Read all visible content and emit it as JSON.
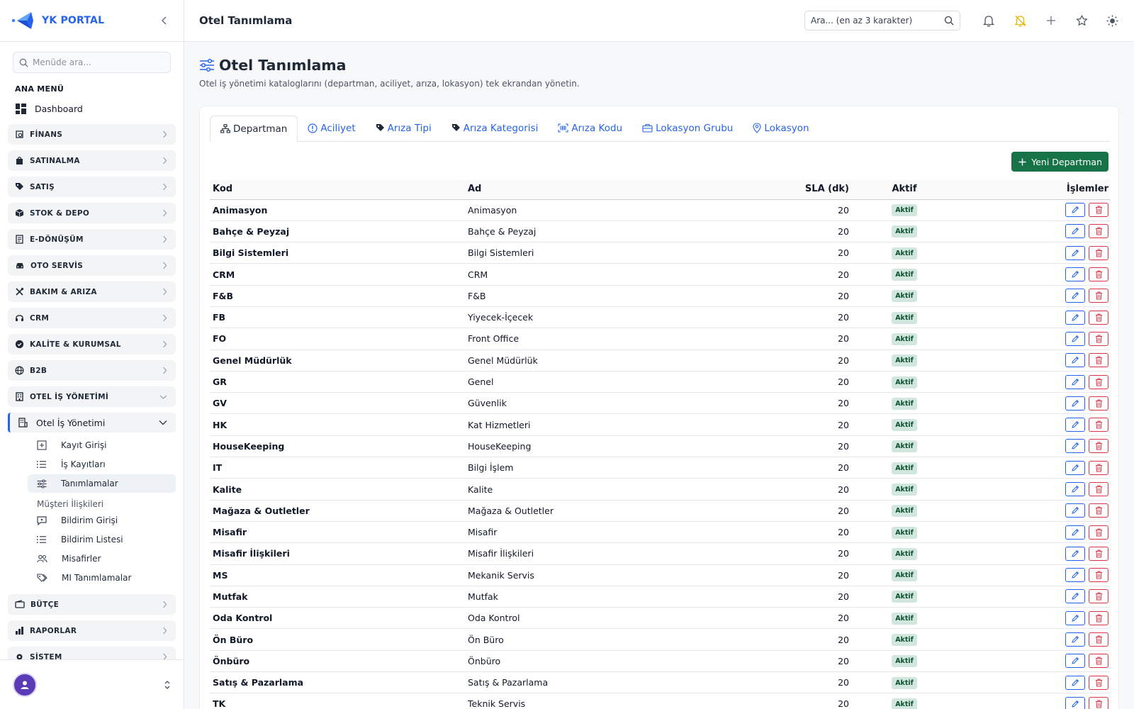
{
  "brand": {
    "name": "YK PORTAL"
  },
  "sidebar": {
    "search_placeholder": "Menüde ara...",
    "section_label": "ANA MENÜ",
    "dashboard_label": "Dashboard",
    "groups_before": [
      {
        "label": "FİNANS",
        "icon": "finance-icon"
      },
      {
        "label": "SATINALMA",
        "icon": "bag-icon"
      },
      {
        "label": "SATIŞ",
        "icon": "tag-icon"
      },
      {
        "label": "STOK & DEPO",
        "icon": "box-icon"
      },
      {
        "label": "E-DÖNÜŞÜM",
        "icon": "document-icon"
      },
      {
        "label": "OTO SERVİS",
        "icon": "car-icon"
      },
      {
        "label": "BAKIM & ARIZA",
        "icon": "tools-icon"
      },
      {
        "label": "CRM",
        "icon": "headset-icon"
      },
      {
        "label": "KALİTE & KURUMSAL",
        "icon": "badge-check-icon"
      },
      {
        "label": "B2B",
        "icon": "globe-icon"
      }
    ],
    "open_group": {
      "label": "OTEL İŞ YÖNETİMİ"
    },
    "sub_parent": {
      "label": "Otel İş Yönetimi"
    },
    "sub_items_1": [
      {
        "label": "Kayıt Girişi",
        "icon": "plus-square-icon"
      },
      {
        "label": "İş Kayıtları",
        "icon": "list-icon"
      },
      {
        "label": "Tanımlamalar",
        "icon": "sliders-icon",
        "active": true
      }
    ],
    "sub_heading": "Müşteri İlişkileri",
    "sub_items_2": [
      {
        "label": "Bildirim Girişi",
        "icon": "message-icon"
      },
      {
        "label": "Bildirim Listesi",
        "icon": "list-icon"
      },
      {
        "label": "Misafirler",
        "icon": "people-icon"
      },
      {
        "label": "MI Tanımlamalar",
        "icon": "tags-icon"
      }
    ],
    "groups_after": [
      {
        "label": "BÜTÇE",
        "icon": "wallet-icon"
      },
      {
        "label": "RAPORLAR",
        "icon": "bar-chart-icon"
      },
      {
        "label": "SİSTEM",
        "icon": "gear-icon"
      }
    ]
  },
  "topbar": {
    "title": "Otel Tanımlama",
    "search_placeholder": "Ara... (en az 3 karakter)"
  },
  "page": {
    "title": "Otel Tanımlama",
    "subtitle": "Otel iş yönetimi kataloglarını (departman, aciliyet, arıza, lokasyon) tek ekrandan yönetin."
  },
  "tabs": [
    {
      "label": "Departman",
      "icon": "diagram-icon",
      "active": true
    },
    {
      "label": "Aciliyet",
      "icon": "alert-circle-icon"
    },
    {
      "label": "Arıza Tipi",
      "icon": "tag-icon"
    },
    {
      "label": "Arıza Kategorisi",
      "icon": "tag-icon"
    },
    {
      "label": "Arıza Kodu",
      "icon": "barcode-icon"
    },
    {
      "label": "Lokasyon Grubu",
      "icon": "briefcase-icon"
    },
    {
      "label": "Lokasyon",
      "icon": "map-pin-icon"
    }
  ],
  "new_button": {
    "label": "Yeni Departman"
  },
  "table": {
    "headers": {
      "kod": "Kod",
      "ad": "Ad",
      "sla": "SLA (dk)",
      "aktif": "Aktif",
      "islemler": "İşlemler"
    },
    "rows": [
      {
        "kod": "Animasyon",
        "ad": "Animasyon",
        "sla": "20",
        "aktif": "Aktif"
      },
      {
        "kod": "Bahçe & Peyzaj",
        "ad": "Bahçe & Peyzaj",
        "sla": "20",
        "aktif": "Aktif"
      },
      {
        "kod": "Bilgi Sistemleri",
        "ad": "Bilgi Sistemleri",
        "sla": "20",
        "aktif": "Aktif"
      },
      {
        "kod": "CRM",
        "ad": "CRM",
        "sla": "20",
        "aktif": "Aktif"
      },
      {
        "kod": "F&B",
        "ad": "F&B",
        "sla": "20",
        "aktif": "Aktif"
      },
      {
        "kod": "FB",
        "ad": "Yiyecek-İçecek",
        "sla": "20",
        "aktif": "Aktif"
      },
      {
        "kod": "FO",
        "ad": "Front Office",
        "sla": "20",
        "aktif": "Aktif"
      },
      {
        "kod": "Genel Müdürlük",
        "ad": "Genel Müdürlük",
        "sla": "20",
        "aktif": "Aktif"
      },
      {
        "kod": "GR",
        "ad": "Genel",
        "sla": "20",
        "aktif": "Aktif"
      },
      {
        "kod": "GV",
        "ad": "Güvenlik",
        "sla": "20",
        "aktif": "Aktif"
      },
      {
        "kod": "HK",
        "ad": "Kat Hizmetleri",
        "sla": "20",
        "aktif": "Aktif"
      },
      {
        "kod": "HouseKeeping",
        "ad": "HouseKeeping",
        "sla": "20",
        "aktif": "Aktif"
      },
      {
        "kod": "IT",
        "ad": "Bilgi İşlem",
        "sla": "20",
        "aktif": "Aktif"
      },
      {
        "kod": "Kalite",
        "ad": "Kalite",
        "sla": "20",
        "aktif": "Aktif"
      },
      {
        "kod": "Mağaza & Outletler",
        "ad": "Mağaza & Outletler",
        "sla": "20",
        "aktif": "Aktif"
      },
      {
        "kod": "Misafir",
        "ad": "Misafir",
        "sla": "20",
        "aktif": "Aktif"
      },
      {
        "kod": "Misafir İlişkileri",
        "ad": "Misafir İlişkileri",
        "sla": "20",
        "aktif": "Aktif"
      },
      {
        "kod": "MS",
        "ad": "Mekanik Servis",
        "sla": "20",
        "aktif": "Aktif"
      },
      {
        "kod": "Mutfak",
        "ad": "Mutfak",
        "sla": "20",
        "aktif": "Aktif"
      },
      {
        "kod": "Oda Kontrol",
        "ad": "Oda Kontrol",
        "sla": "20",
        "aktif": "Aktif"
      },
      {
        "kod": "Ön Büro",
        "ad": "Ön Büro",
        "sla": "20",
        "aktif": "Aktif"
      },
      {
        "kod": "Önbüro",
        "ad": "Önbüro",
        "sla": "20",
        "aktif": "Aktif"
      },
      {
        "kod": "Satış & Pazarlama",
        "ad": "Satış & Pazarlama",
        "sla": "20",
        "aktif": "Aktif"
      },
      {
        "kod": "TK",
        "ad": "Teknik Servis",
        "sla": "20",
        "aktif": "Aktif"
      }
    ]
  },
  "colors": {
    "primary": "#2563eb",
    "success": "#157347",
    "danger": "#dc3545",
    "badge_bg": "#d1e7dd",
    "badge_text": "#0f5132"
  }
}
